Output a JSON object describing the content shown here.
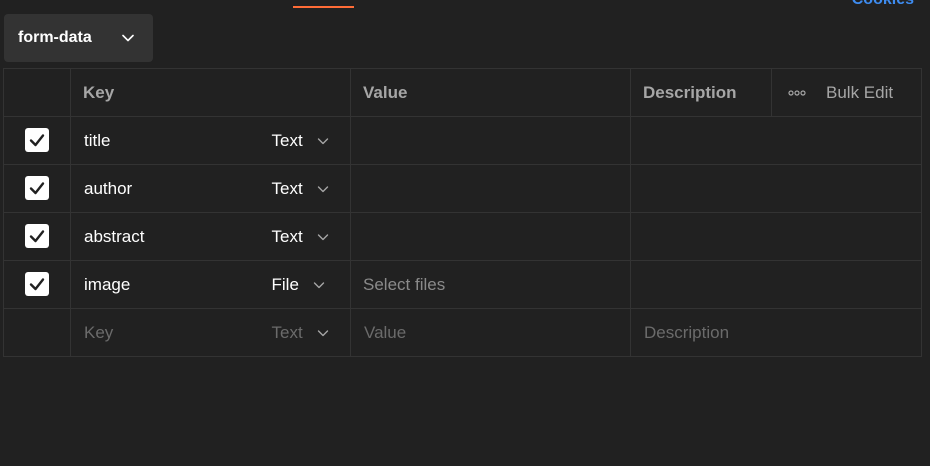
{
  "top_link": "Cookies",
  "body_type": {
    "selected": "form-data"
  },
  "table": {
    "headers": {
      "key": "Key",
      "value": "Value",
      "description": "Description",
      "bulk_edit": "Bulk Edit"
    },
    "rows": [
      {
        "checked": true,
        "key": "title",
        "type": "Text",
        "value": "",
        "description": ""
      },
      {
        "checked": true,
        "key": "author",
        "type": "Text",
        "value": "",
        "description": ""
      },
      {
        "checked": true,
        "key": "abstract",
        "type": "Text",
        "value": "",
        "description": ""
      },
      {
        "checked": true,
        "key": "image",
        "type": "File",
        "value": "Select files",
        "description": ""
      }
    ],
    "new_row": {
      "key_placeholder": "Key",
      "type": "Text",
      "value_placeholder": "Value",
      "description_placeholder": "Description"
    }
  },
  "icons": {
    "checkbox": "check-icon",
    "dropdown": "chevron-down-icon",
    "more": "more-horizontal-icon"
  },
  "colors": {
    "background": "#212121",
    "border": "#333333",
    "accent": "#ff6c37",
    "link": "#3e8cf0",
    "muted_text": "#a6a6a6",
    "placeholder": "#6b6b6b"
  }
}
